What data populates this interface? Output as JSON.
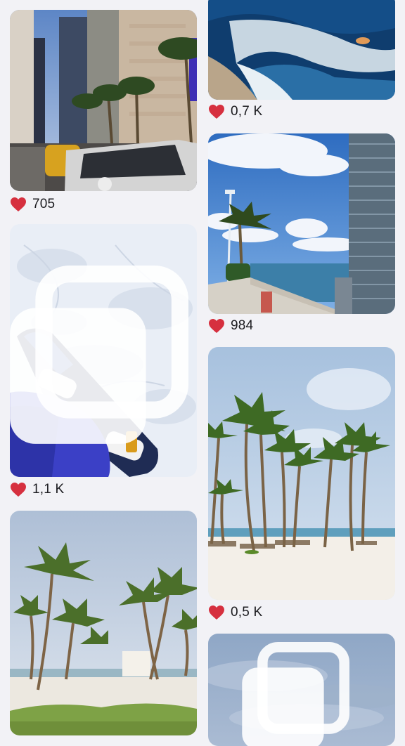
{
  "colors": {
    "heart": "#d6303f",
    "background": "#f2f2f6",
    "text": "#1b1b1f"
  },
  "icons": {
    "like": "heart-icon",
    "multi": "multi-photo-icon"
  },
  "feed": {
    "left": [
      {
        "name": "city-street-photo",
        "likes": "705"
      },
      {
        "name": "snowboard-photo",
        "likes": "1,1 K",
        "multi": true
      },
      {
        "name": "palm-resort-photo",
        "likes": ""
      }
    ],
    "right": [
      {
        "name": "ocean-waves-photo",
        "likes": "0,7 K"
      },
      {
        "name": "waterfront-tower-photo",
        "likes": "984"
      },
      {
        "name": "palm-beach-photo",
        "likes": "0,5 K"
      },
      {
        "name": "sky-clouds-photo",
        "likes": "",
        "multi": true
      }
    ]
  }
}
